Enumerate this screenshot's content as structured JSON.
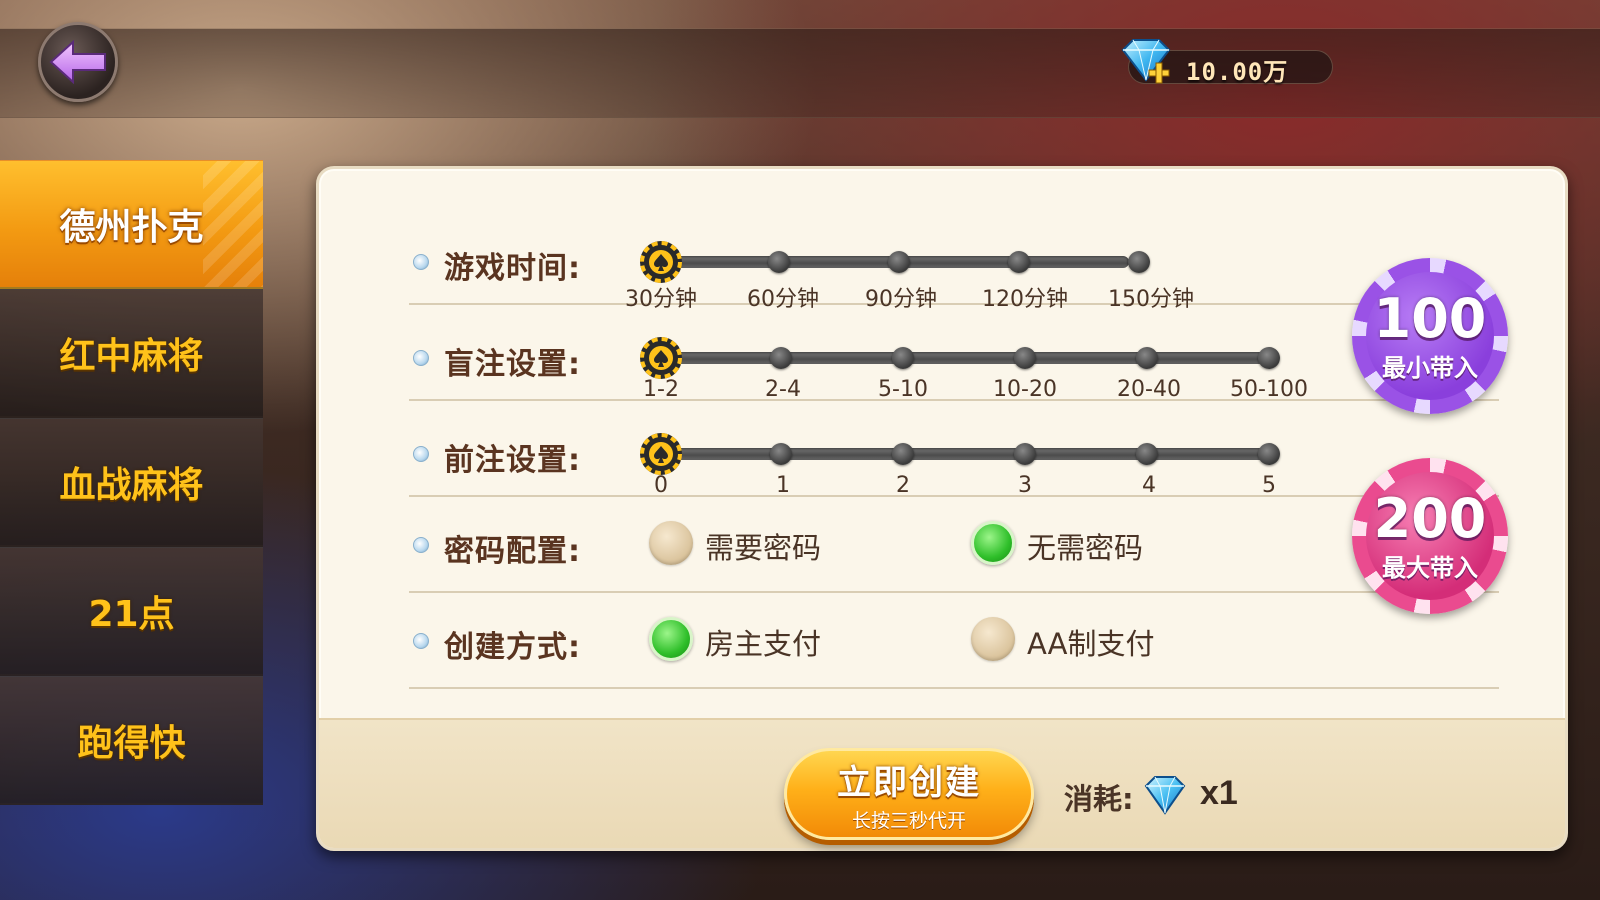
{
  "header": {
    "diamond_balance": "10.00万"
  },
  "sidebar": {
    "items": [
      {
        "label": "德州扑克",
        "active": true
      },
      {
        "label": "红中麻将",
        "active": false
      },
      {
        "label": "血战麻将",
        "active": false
      },
      {
        "label": "21点",
        "active": false
      },
      {
        "label": "跑得快",
        "active": false
      }
    ]
  },
  "settings": {
    "game_time": {
      "label": "游戏时间:",
      "options": [
        "30分钟",
        "60分钟",
        "90分钟",
        "120分钟",
        "150分钟"
      ],
      "selected": "30分钟"
    },
    "blinds": {
      "label": "盲注设置:",
      "options": [
        "1-2",
        "2-4",
        "5-10",
        "10-20",
        "20-40",
        "50-100"
      ],
      "selected": "1-2"
    },
    "ante": {
      "label": "前注设置:",
      "options": [
        "0",
        "1",
        "2",
        "3",
        "4",
        "5"
      ],
      "selected": "0"
    },
    "password": {
      "label": "密码配置:",
      "options": [
        "需要密码",
        "无需密码"
      ],
      "selected": "无需密码"
    },
    "payment": {
      "label": "创建方式:",
      "options": [
        "房主支付",
        "AA制支付"
      ],
      "selected": "房主支付"
    }
  },
  "chips": {
    "min_buyin": {
      "value": "100",
      "label": "最小带入"
    },
    "max_buyin": {
      "value": "200",
      "label": "最大带入"
    }
  },
  "footer": {
    "create_label": "立即创建",
    "create_sub": "长按三秒代开",
    "cost_label": "消耗:",
    "cost_qty": "x1"
  },
  "colors": {
    "accent": "#f39a12",
    "sidebar_text": "#ffc21a",
    "panel_bg": "#fbf6ea",
    "radio_on": "#2fbf2a"
  }
}
